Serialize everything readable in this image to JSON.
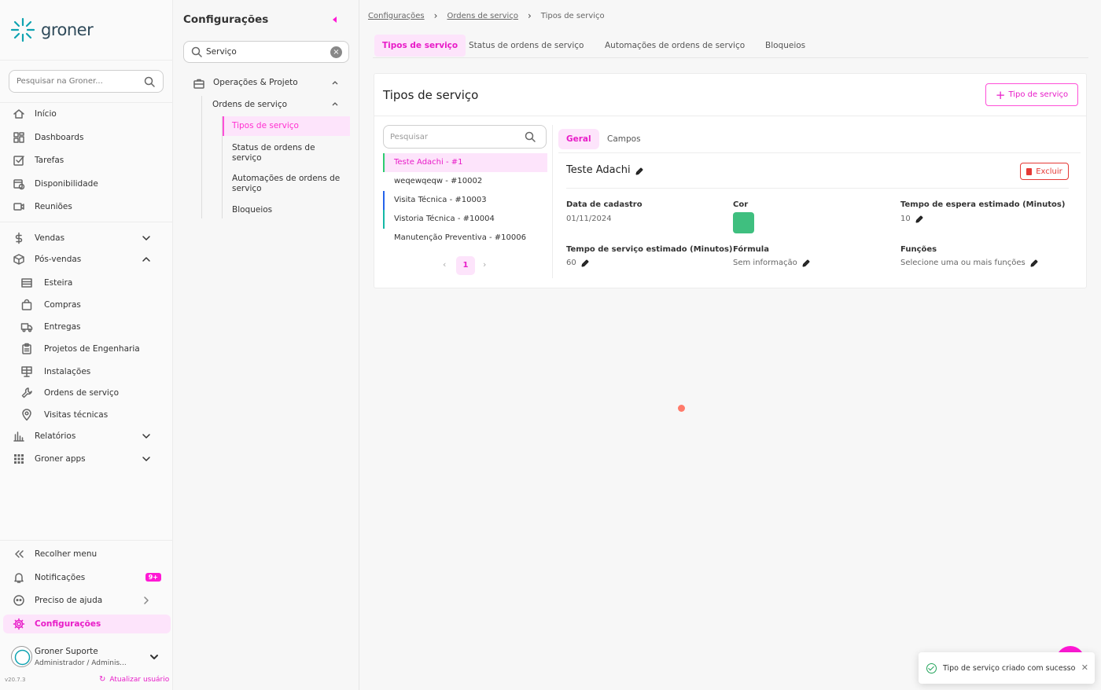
{
  "app": {
    "name": "groner",
    "version": "v20.7.3"
  },
  "sidebar": {
    "search_placeholder": "Pesquisar na Groner...",
    "items": [
      {
        "label": "Início",
        "icon": "home-icon"
      },
      {
        "label": "Dashboards",
        "icon": "dashboard-icon"
      },
      {
        "label": "Tarefas",
        "icon": "checkbox-icon"
      },
      {
        "label": "Disponibilidade",
        "icon": "calendar-clock-icon"
      },
      {
        "label": "Reuniões",
        "icon": "video-icon"
      },
      {
        "label": "Vendas",
        "icon": "dollar-icon"
      },
      {
        "label": "Pós-vendas",
        "icon": "box-icon"
      },
      {
        "label": "Esteira",
        "icon": "list-icon"
      },
      {
        "label": "Compras",
        "icon": "shopping-bag-icon"
      },
      {
        "label": "Entregas",
        "icon": "truck-icon"
      },
      {
        "label": "Projetos de Engenharia",
        "icon": "clipboard-icon"
      },
      {
        "label": "Instalações",
        "icon": "solar-panel-icon"
      },
      {
        "label": "Ordens de serviço",
        "icon": "wrench-icon"
      },
      {
        "label": "Visitas técnicas",
        "icon": "location-pin-icon"
      },
      {
        "label": "Relatórios",
        "icon": "bar-chart-icon"
      },
      {
        "label": "Groner apps",
        "icon": "grid-icon"
      }
    ],
    "bottom": {
      "collapse": "Recolher menu",
      "notifications": "Notificações",
      "notifications_badge": "9+",
      "help": "Preciso de ajuda",
      "settings": "Configurações"
    },
    "user": {
      "name": "Groner Suporte",
      "role": "Administrador / Adminis..."
    },
    "update_user": "Atualizar usuário"
  },
  "settings_panel": {
    "title": "Configurações",
    "search_value": "Serviço",
    "tree": {
      "group": "Operações & Projeto",
      "subgroup": "Ordens de serviço",
      "items": [
        "Tipos de serviço",
        "Status de ordens de serviço",
        "Automações de ordens de serviço",
        "Bloqueios"
      ]
    }
  },
  "main": {
    "breadcrumb": [
      "Configurações",
      "Ordens de serviço",
      "Tipos de serviço"
    ],
    "tabs": [
      "Tipos de serviço",
      "Status de ordens de serviço",
      "Automações de ordens de serviço",
      "Bloqueios"
    ],
    "card": {
      "title": "Tipos de serviço",
      "add_button": "Tipo de serviço",
      "search_placeholder": "Pesquisar",
      "list": [
        {
          "label": "Teste Adachi - #1",
          "color": "#2ecc71"
        },
        {
          "label": "weqewqeqw - #10002",
          "color": ""
        },
        {
          "label": "Visita Técnica - #10003",
          "color": "#2563eb"
        },
        {
          "label": "Vistoria Técnica - #10004",
          "color": "#14b8a6"
        },
        {
          "label": "Manutenção Preventiva - #10006",
          "color": ""
        }
      ],
      "page": "1",
      "detail_tabs": [
        "Geral",
        "Campos"
      ],
      "detail": {
        "name": "Teste Adachi",
        "delete_button": "Excluir",
        "fields": {
          "created_label": "Data de cadastro",
          "created_value": "01/11/2024",
          "color_label": "Cor",
          "color_value": "#3fbf7f",
          "wait_label": "Tempo de espera estimado (Minutos)",
          "wait_value": "10",
          "service_label": "Tempo de serviço estimado (Minutos)",
          "service_value": "60",
          "formula_label": "Fórmula",
          "formula_value": "Sem informação",
          "functions_label": "Funções",
          "functions_value": "Selecione uma ou mais funções"
        }
      }
    }
  },
  "toast": {
    "message": "Tipo de serviço criado com sucesso"
  },
  "colors": {
    "accent": "#e81cc8",
    "accent_bg": "#fde4fb",
    "danger": "#e53935",
    "success": "#22a35a"
  }
}
